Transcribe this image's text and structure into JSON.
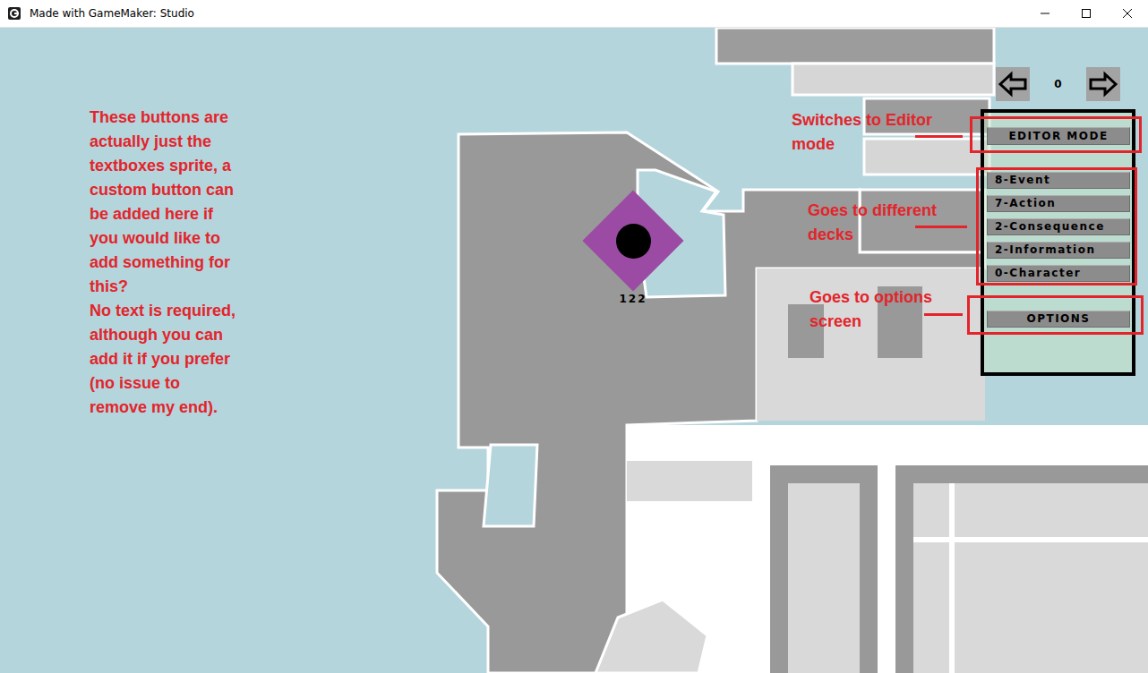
{
  "window": {
    "title": "Made with GameMaker: Studio"
  },
  "note": {
    "lines": [
      "These buttons are",
      "actually just the",
      "textboxes sprite, a",
      "custom button can",
      "be added here if",
      "you would like to",
      "add something for",
      "this?",
      "No text is required,",
      "although you can",
      "add it if you prefer",
      "(no issue to",
      "remove my end)."
    ]
  },
  "marker": {
    "label": "122",
    "color": "#9b4ba3"
  },
  "pager": {
    "count": "0"
  },
  "panel": {
    "editor_button": "EDITOR MODE",
    "decks": [
      {
        "label": "8-Event"
      },
      {
        "label": "7-Action"
      },
      {
        "label": "2-Consequence"
      },
      {
        "label": "2-Information"
      },
      {
        "label": "0-Character"
      }
    ],
    "options_button": "OPTIONS"
  },
  "callouts": [
    {
      "lines": [
        "Switches to Editor",
        "mode"
      ]
    },
    {
      "lines": [
        "Goes to different",
        "decks"
      ]
    },
    {
      "lines": [
        "Goes to options",
        "screen"
      ]
    }
  ]
}
